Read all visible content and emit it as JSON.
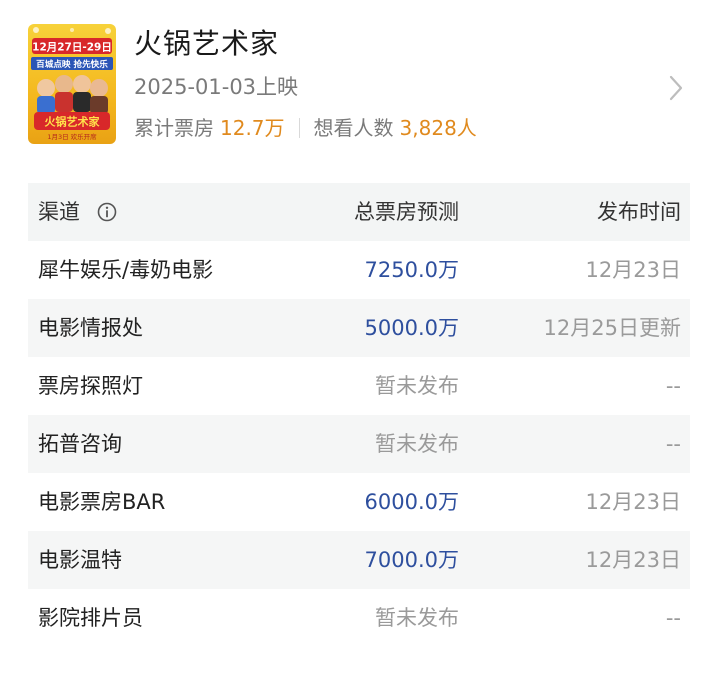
{
  "movie": {
    "title": "火锅艺术家",
    "release": "2025-01-03上映",
    "box_office_label": "累计票房",
    "box_office_value": "12.7万",
    "want_label": "想看人数",
    "want_value": "3,828人",
    "poster_text": {
      "dates": "12月27日-29日",
      "line2": "百城点映 抢先快乐",
      "title": "火锅艺术家",
      "bottom": "1月3日 欢乐开席"
    }
  },
  "table": {
    "headers": {
      "channel": "渠道",
      "forecast": "总票房预测",
      "publish_time": "发布时间"
    },
    "rows": [
      {
        "channel": "犀牛娱乐/毒奶电影",
        "forecast": "7250.0万",
        "time": "12月23日",
        "status": "value"
      },
      {
        "channel": "电影情报处",
        "forecast": "5000.0万",
        "time": "12月25日更新",
        "status": "value"
      },
      {
        "channel": "票房探照灯",
        "forecast": "暂未发布",
        "time": "--",
        "status": "none"
      },
      {
        "channel": "拓普咨询",
        "forecast": "暂未发布",
        "time": "--",
        "status": "none"
      },
      {
        "channel": "电影票房BAR",
        "forecast": "6000.0万",
        "time": "12月23日",
        "status": "value"
      },
      {
        "channel": "电影温特",
        "forecast": "7000.0万",
        "time": "12月23日",
        "status": "value"
      },
      {
        "channel": "影院排片员",
        "forecast": "暂未发布",
        "time": "--",
        "status": "none"
      }
    ]
  },
  "colors": {
    "accent_orange": "#e08a1e",
    "value_blue": "#2e4f9e",
    "muted_grey": "#9a9a9a"
  },
  "icons": {
    "info": "info-circle-icon",
    "chevron": "chevron-right-icon"
  }
}
